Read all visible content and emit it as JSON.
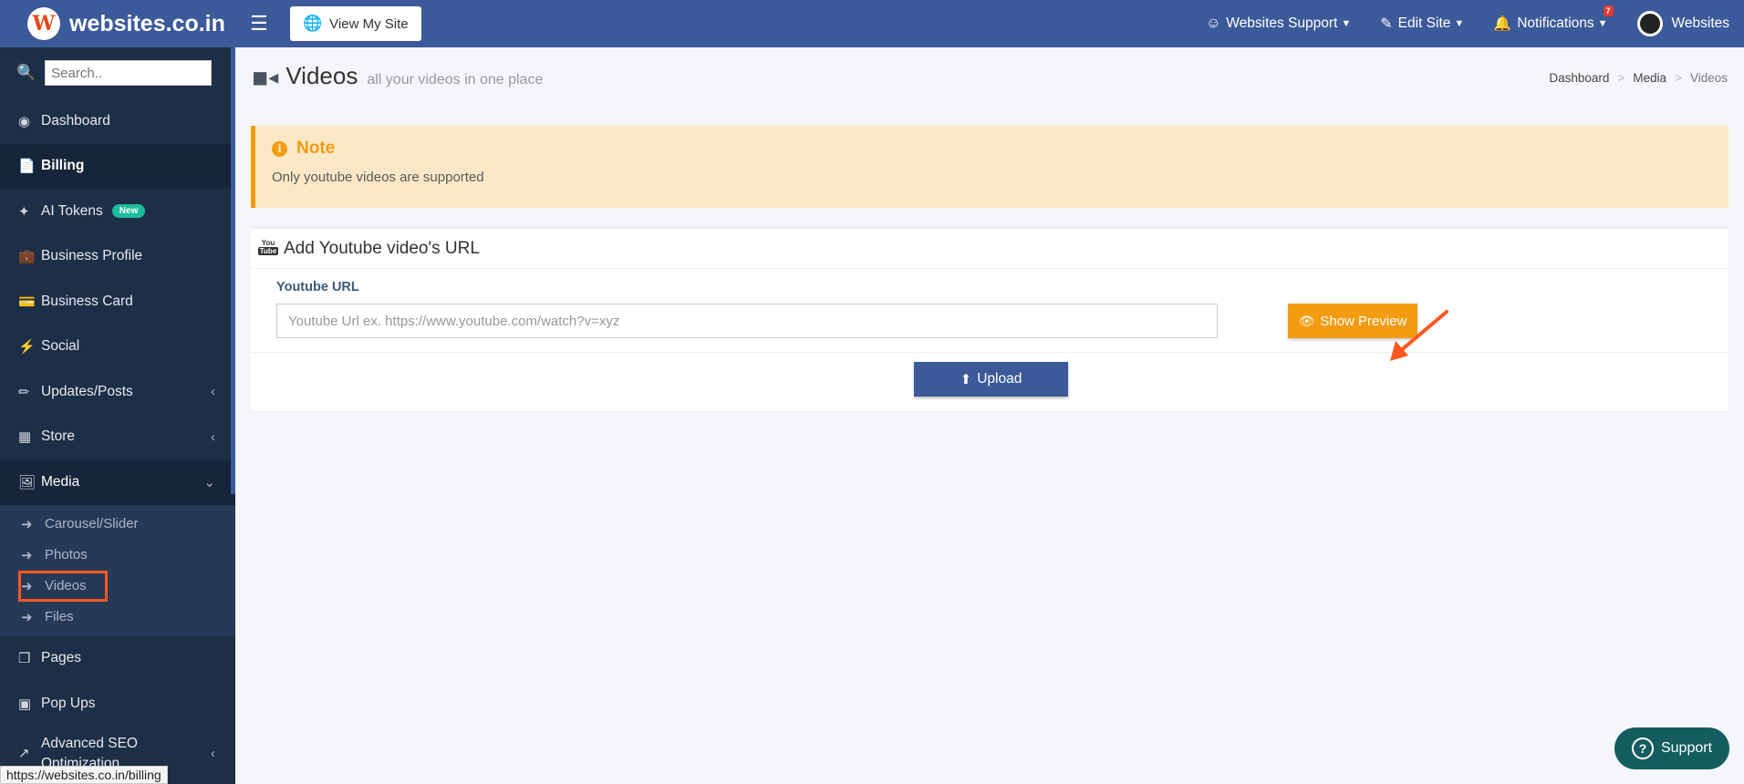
{
  "brand": {
    "name": "websites.co.in",
    "logo_letter": "W"
  },
  "header": {
    "menu_icon": "hamburger-icon",
    "view_site_label": "View My Site",
    "support_label": "Websites Support",
    "edit_site_label": "Edit Site",
    "notifications_label": "Notifications",
    "notifications_count": "7",
    "account_label": "Websites"
  },
  "sidebar": {
    "search_placeholder": "Search..",
    "items": [
      {
        "label": "Dashboard"
      },
      {
        "label": "Billing"
      },
      {
        "label": "AI Tokens",
        "badge": "New"
      },
      {
        "label": "Business Profile"
      },
      {
        "label": "Business Card"
      },
      {
        "label": "Social"
      },
      {
        "label": "Updates/Posts"
      },
      {
        "label": "Store"
      },
      {
        "label": "Media"
      },
      {
        "label": "Pages"
      },
      {
        "label": "Pop Ups"
      },
      {
        "label": "Advanced SEO Optimization"
      }
    ],
    "media_submenu": [
      {
        "label": "Carousel/Slider"
      },
      {
        "label": "Photos"
      },
      {
        "label": "Videos"
      },
      {
        "label": "Files"
      }
    ]
  },
  "status_url": "https://websites.co.in/billing",
  "page": {
    "title": "Videos",
    "subtitle": "all your videos in one place",
    "breadcrumb": [
      "Dashboard",
      "Media",
      "Videos"
    ]
  },
  "note": {
    "title": "Note",
    "text": "Only youtube videos are supported"
  },
  "form": {
    "header": "Add Youtube video's URL",
    "url_label": "Youtube URL",
    "url_placeholder": "Youtube Url ex. https://www.youtube.com/watch?v=xyz",
    "url_value": "",
    "preview_label": "Show Preview",
    "upload_label": "Upload"
  },
  "support_label": "Support",
  "colors": {
    "primary": "#3c5a99",
    "sidebar": "#1d2e47",
    "warning": "#f39c12",
    "annotation": "#ff5722",
    "support": "#135d5e"
  }
}
